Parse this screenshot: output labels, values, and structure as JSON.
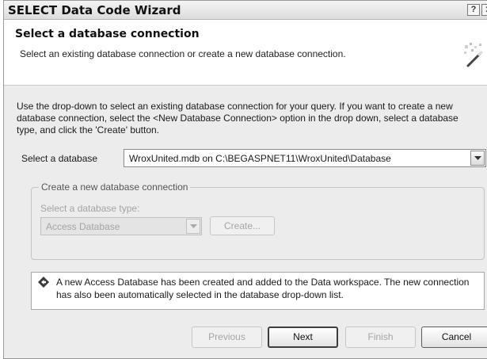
{
  "window": {
    "title": "SELECT Data Code Wizard",
    "help_glyph": "?",
    "close_glyph": "✕"
  },
  "header": {
    "title": "Select a database connection",
    "subtitle": "Select an existing database connection or create a new database connection."
  },
  "instructions": "Use the drop-down to select an existing database connection for your query.  If you want to create a new database connection, select the <New Database Connection> option in the drop down, select a database type, and click the 'Create' button.",
  "select_database": {
    "label": "Select a database",
    "value": "WroxUnited.mdb on C:\\BEGASPNET11\\WroxUnited\\Database"
  },
  "create_connection": {
    "legend": "Create a new database connection",
    "type_label": "Select a database type:",
    "type_value": "Access Database",
    "create_label": "Create..."
  },
  "info_message": "A new Access Database has been created and added to the Data workspace.  The new connection has also been automatically selected in the database drop-down list.",
  "buttons": {
    "previous": "Previous",
    "next": "Next",
    "finish": "Finish",
    "cancel": "Cancel"
  },
  "icons": {
    "wizard": "magic-wand-icon",
    "info": "info-diamond-icon",
    "dropdown": "chevron-down-icon"
  }
}
